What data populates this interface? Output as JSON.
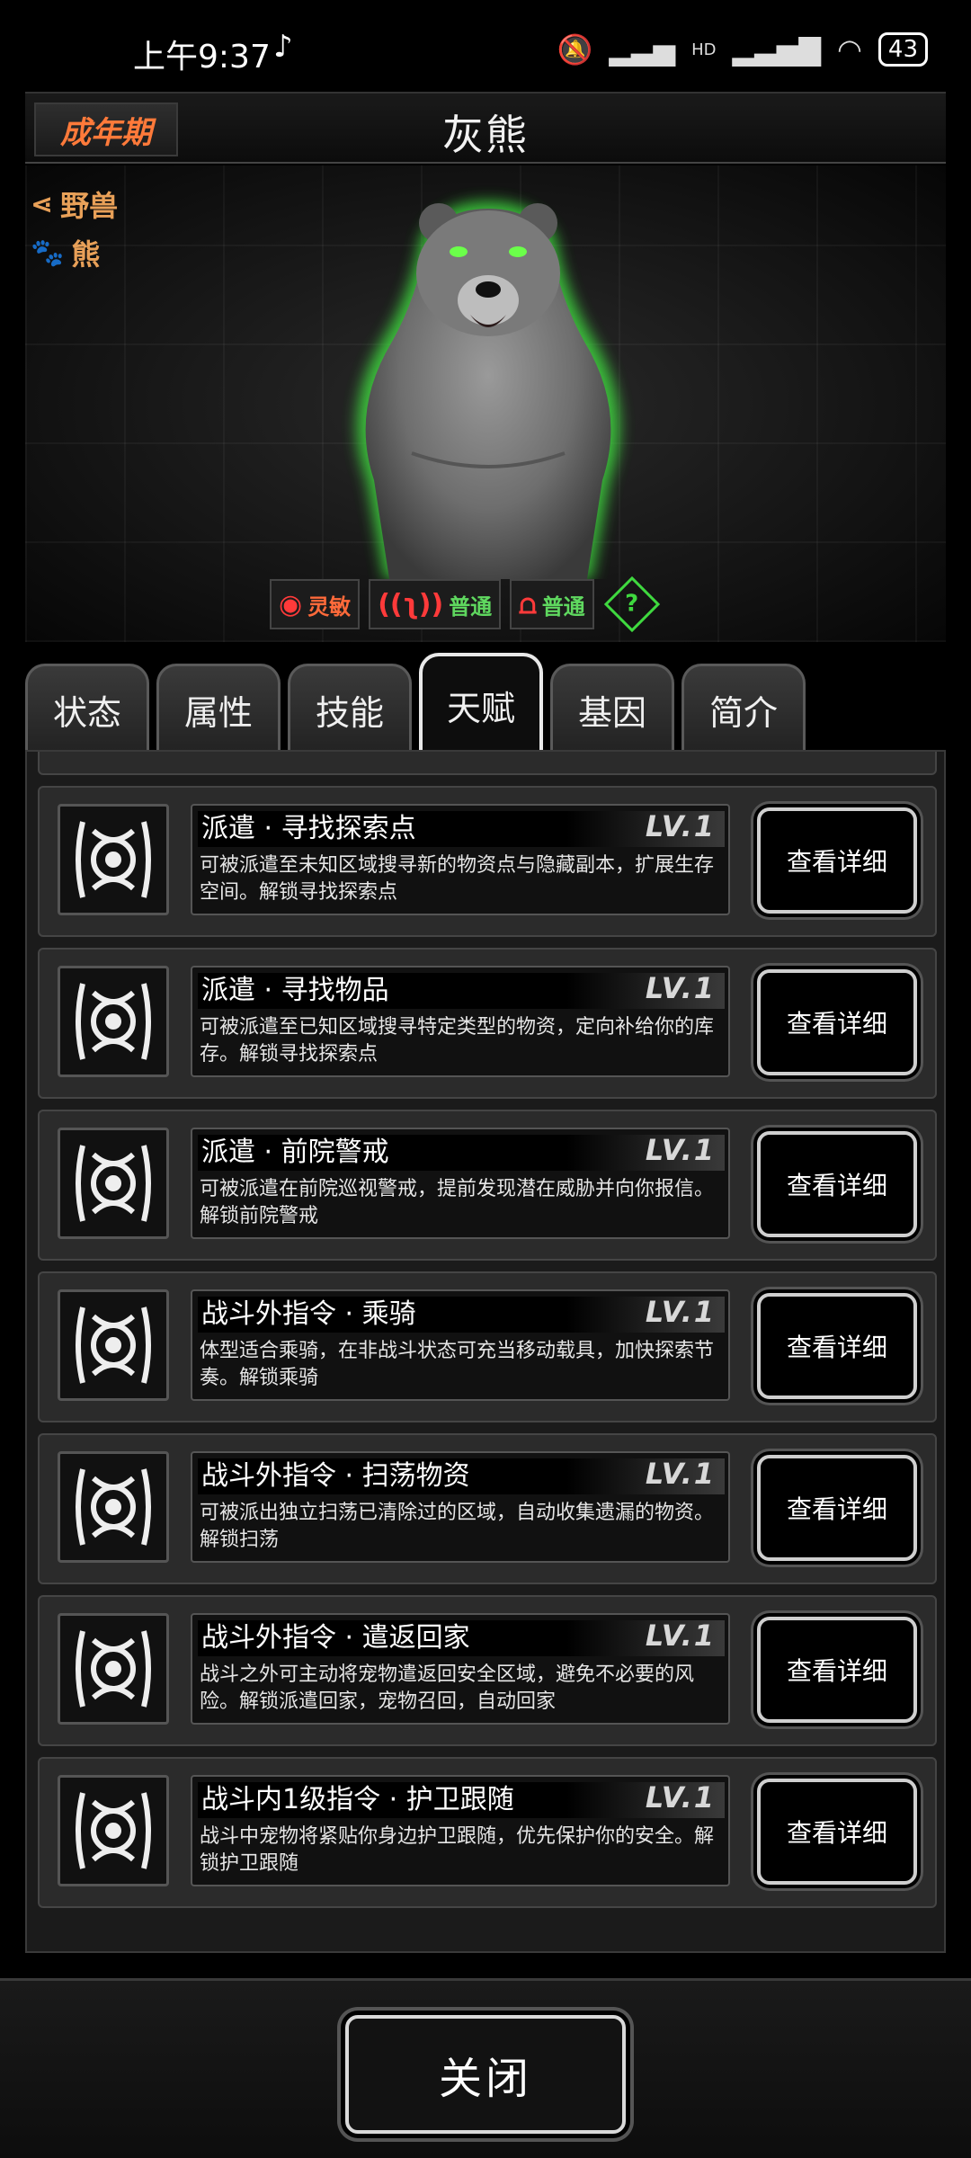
{
  "status_bar": {
    "time": "上午9:37",
    "battery": "43",
    "network_label": "HD"
  },
  "header": {
    "stage": "成年期",
    "title": "灰熊"
  },
  "creature": {
    "tags": [
      {
        "icon": "share-icon",
        "label": "野兽"
      },
      {
        "icon": "paw-icon",
        "label": "熊"
      }
    ],
    "senses": [
      {
        "icon": "eye-icon",
        "label": "灵敏",
        "color": "#ff6a3a"
      },
      {
        "icon": "ear-icon",
        "label": "普通",
        "color": "#5fd85f"
      },
      {
        "icon": "nose-icon",
        "label": "普通",
        "color": "#5fd85f"
      }
    ],
    "glow_color": "#3fd93f"
  },
  "tabs": [
    {
      "label": "状态",
      "active": false
    },
    {
      "label": "属性",
      "active": false
    },
    {
      "label": "技能",
      "active": false
    },
    {
      "label": "天赋",
      "active": true
    },
    {
      "label": "基因",
      "active": false
    },
    {
      "label": "简介",
      "active": false
    }
  ],
  "talents": [
    {
      "title": "派遣 · 寻找探索点",
      "level": "LV.1",
      "description": "可被派遣至未知区域搜寻新的物资点与隐藏副本，扩展生存空间。解锁寻找探索点",
      "button": "查看详细"
    },
    {
      "title": "派遣 · 寻找物品",
      "level": "LV.1",
      "description": "可被派遣至已知区域搜寻特定类型的物资，定向补给你的库存。解锁寻找探索点",
      "button": "查看详细"
    },
    {
      "title": "派遣 · 前院警戒",
      "level": "LV.1",
      "description": "可被派遣在前院巡视警戒，提前发现潜在威胁并向你报信。解锁前院警戒",
      "button": "查看详细"
    },
    {
      "title": "战斗外指令 · 乘骑",
      "level": "LV.1",
      "description": "体型适合乘骑，在非战斗状态可充当移动载具，加快探索节奏。解锁乘骑",
      "button": "查看详细"
    },
    {
      "title": "战斗外指令 · 扫荡物资",
      "level": "LV.1",
      "description": "可被派出独立扫荡已清除过的区域，自动收集遗漏的物资。解锁扫荡",
      "button": "查看详细"
    },
    {
      "title": "战斗外指令 · 遣返回家",
      "level": "LV.1",
      "description": "战斗之外可主动将宠物遣返回安全区域，避免不必要的风险。解锁派遣回家，宠物召回，自动回家",
      "button": "查看详细"
    },
    {
      "title": "战斗内1级指令 · 护卫跟随",
      "level": "LV.1",
      "description": "战斗中宠物将紧贴你身边护卫跟随，优先保护你的安全。解锁护卫跟随",
      "button": "查看详细"
    }
  ],
  "footer": {
    "close_label": "关闭"
  }
}
